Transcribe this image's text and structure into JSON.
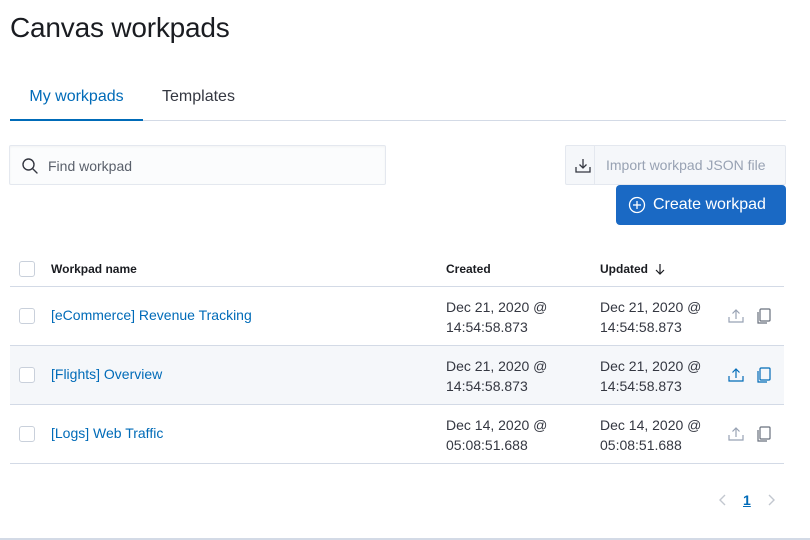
{
  "page": {
    "title": "Canvas workpads"
  },
  "tabs": [
    {
      "label": "My workpads",
      "active": true
    },
    {
      "label": "Templates",
      "active": false
    }
  ],
  "search": {
    "placeholder": "Find workpad",
    "value": ""
  },
  "import": {
    "label": "Import workpad JSON file",
    "icon": "import-icon"
  },
  "create": {
    "label": "Create workpad",
    "icon": "plus-circle-icon"
  },
  "table": {
    "columns": {
      "name": "Workpad name",
      "created": "Created",
      "updated": "Updated",
      "sort_icon": "arrow-down-icon"
    },
    "rows": [
      {
        "name": "[eCommerce] Revenue Tracking",
        "created_date": "Dec 21, 2020 @",
        "created_time": "14:54:58.873",
        "updated_date": "Dec 21, 2020 @",
        "updated_time": "14:54:58.873"
      },
      {
        "name": "[Flights] Overview",
        "created_date": "Dec 21, 2020 @",
        "created_time": "14:54:58.873",
        "updated_date": "Dec 21, 2020 @",
        "updated_time": "14:54:58.873"
      },
      {
        "name": "[Logs] Web Traffic",
        "created_date": "Dec 14, 2020 @",
        "created_time": "05:08:51.688",
        "updated_date": "Dec 14, 2020 @",
        "updated_time": "05:08:51.688"
      }
    ]
  },
  "pagination": {
    "current": "1"
  },
  "colors": {
    "accent": "#006bb8",
    "button": "#1a69c4",
    "muted_icon": "#98a2b3"
  }
}
